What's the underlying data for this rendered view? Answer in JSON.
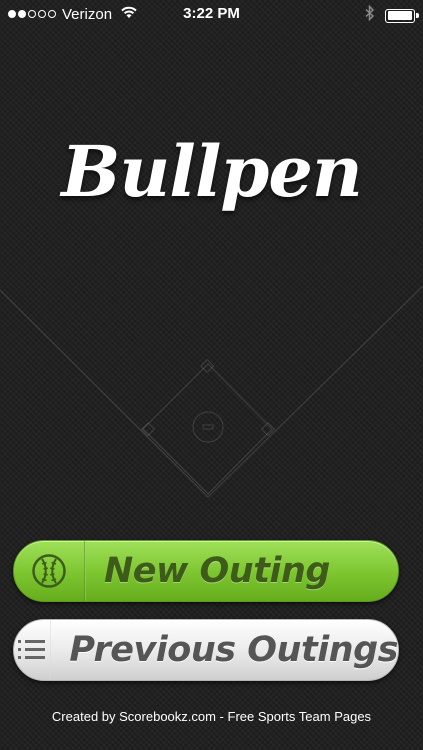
{
  "status_bar": {
    "signal_bars_filled": 2,
    "signal_bars_total": 5,
    "carrier": "Verizon",
    "time": "3:22 PM",
    "battery_level": 0.95,
    "icons": [
      "wifi-icon",
      "bluetooth-icon",
      "battery-icon"
    ]
  },
  "app": {
    "logo_text": "Bullpen"
  },
  "buttons": {
    "new_outing": {
      "label": "New Outing",
      "icon": "baseball-icon",
      "color": "#7cc52f"
    },
    "previous_outings": {
      "label": "Previous Outings",
      "icon": "list-icon",
      "color": "#e9e9e9"
    }
  },
  "footer": {
    "text": "Created by Scorebookz.com - Free Sports Team Pages"
  }
}
